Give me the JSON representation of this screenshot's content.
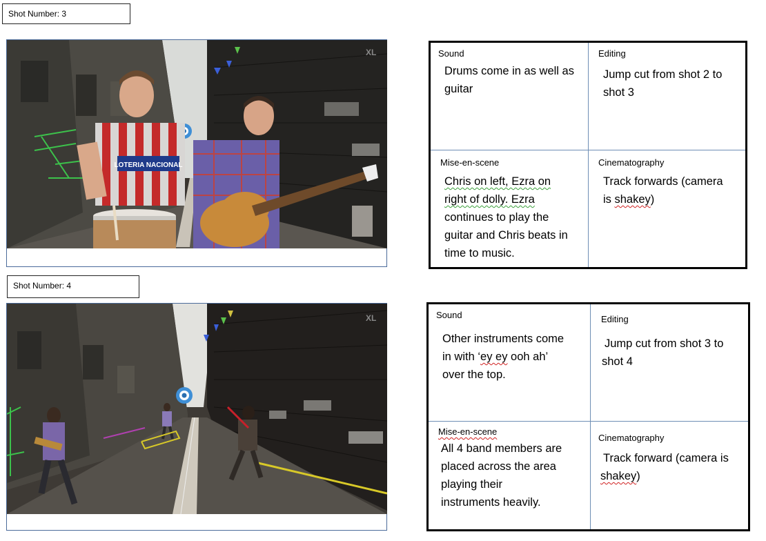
{
  "shots": [
    {
      "label": "Shot Number: 3",
      "sound_title": "Sound",
      "sound_text": [
        "Drums come in as well as",
        "guitar"
      ],
      "editing_title": "Editing",
      "editing_text": [
        "Jump cut from shot 2 to",
        "shot 3"
      ],
      "mise_title": "Mise-en-scene",
      "mise_text": [
        "Chris on left, Ezra on",
        "right of dolly. Ezra",
        "continues to play the",
        "guitar and Chris beats in",
        "time to music."
      ],
      "cine_title": "Cinematography",
      "cine_text_a": "Track forwards (camera",
      "cine_text_b_pre": "is ",
      "cine_text_b_word": "shakey",
      "cine_text_b_post": ")",
      "frame_logo": "XL",
      "jersey_text": "LOTERIA NACIONAL"
    },
    {
      "label": "Shot Number: 4",
      "sound_title": "Sound",
      "sound_text_1": "Other instruments come",
      "sound_text_2_pre": "in with ‘",
      "sound_text_2_squig": "ey ey",
      "sound_text_2_post": " ooh ah’",
      "sound_text_3": "over the top.",
      "editing_title": "Editing",
      "editing_text": [
        "Jump cut from shot 3 to",
        "shot 4"
      ],
      "mise_title": "Mise-en-scene",
      "mise_text": [
        "All 4 band members are",
        "placed across the area",
        "playing their",
        "instruments heavily."
      ],
      "cine_title": "Cinematography",
      "cine_text_a": "Track forward (camera is",
      "cine_text_b_word": "shakey",
      "cine_text_b_post": ")",
      "frame_logo": "XL"
    }
  ],
  "colors": {
    "grid_border": "#000000",
    "cell_divider": "#6d8db4",
    "spell_error": "#d02020",
    "grammar_error": "#3aa03a"
  }
}
